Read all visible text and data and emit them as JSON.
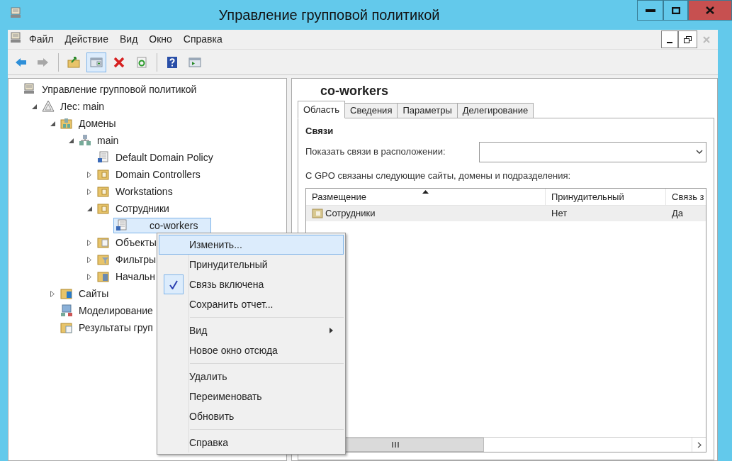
{
  "window": {
    "title": "Управление групповой политикой"
  },
  "menu_bar": [
    "Файл",
    "Действие",
    "Вид",
    "Окно",
    "Справка"
  ],
  "toolbar": [
    {
      "kind": "back",
      "disabled": false
    },
    {
      "kind": "forward",
      "disabled": true
    },
    {
      "kind": "sep"
    },
    {
      "kind": "up",
      "disabled": false
    },
    {
      "kind": "tree",
      "disabled": false,
      "selected": true
    },
    {
      "kind": "delete",
      "disabled": false
    },
    {
      "kind": "refresh",
      "disabled": false
    },
    {
      "kind": "sep"
    },
    {
      "kind": "help",
      "disabled": false
    },
    {
      "kind": "pane",
      "disabled": false
    }
  ],
  "tree": [
    {
      "label": "Управление групповой политикой",
      "kind": "console",
      "selected": false,
      "children": [
        {
          "label": "Лес: main",
          "kind": "forest",
          "expanded": true,
          "selected": false,
          "children": [
            {
              "label": "Домены",
              "kind": "domains",
              "expanded": true,
              "selected": false,
              "children": [
                {
                  "label": "main",
                  "kind": "domain",
                  "expanded": true,
                  "selected": false,
                  "children": [
                    {
                      "label": "Default Domain Policy",
                      "kind": "gpo",
                      "selected": false
                    },
                    {
                      "label": "Domain Controllers",
                      "kind": "ou",
                      "expanded": false,
                      "selected": false
                    },
                    {
                      "label": "Workstations",
                      "kind": "ou",
                      "expanded": false,
                      "selected": false
                    },
                    {
                      "label": "Сотрудники",
                      "kind": "ou",
                      "expanded": true,
                      "selected": false,
                      "children": [
                        {
                          "label": "co-workers",
                          "kind": "gpo",
                          "selected": true
                        }
                      ]
                    },
                    {
                      "label": "Объекты",
                      "kind": "folder",
                      "expanded": false,
                      "selected": false
                    },
                    {
                      "label": "Фильтры",
                      "kind": "filter",
                      "expanded": false,
                      "selected": false
                    },
                    {
                      "label": "Начальн",
                      "kind": "starter",
                      "expanded": false,
                      "selected": false
                    }
                  ]
                }
              ]
            },
            {
              "label": "Сайты",
              "kind": "sites",
              "expanded": false,
              "selected": false
            },
            {
              "label": "Моделирование",
              "kind": "modeling",
              "selected": false
            },
            {
              "label": "Результаты груп",
              "kind": "results",
              "selected": false
            }
          ]
        }
      ]
    }
  ],
  "details": {
    "title": "co-workers",
    "tabs": [
      {
        "label": "Область",
        "selected": true
      },
      {
        "label": "Сведения",
        "selected": false
      },
      {
        "label": "Параметры",
        "selected": false
      },
      {
        "label": "Делегирование",
        "selected": false
      }
    ],
    "section": "Связи",
    "location_label": "Показать связи в расположении:",
    "links_caption": "С GPO связаны следующие сайты, домены и подразделения:",
    "table": {
      "columns": [
        "Размещение",
        "Принудительный",
        "Связь з"
      ],
      "rows": [
        {
          "cells": [
            "Сотрудники",
            "Нет",
            "Да"
          ],
          "selected": true
        }
      ]
    }
  },
  "context_menu": [
    {
      "kind": "item",
      "label": "Изменить...",
      "selected": true,
      "checked": false
    },
    {
      "kind": "item",
      "label": "Принудительный",
      "selected": false,
      "checked": false
    },
    {
      "kind": "item",
      "label": "Связь включена",
      "selected": false,
      "checked": true
    },
    {
      "kind": "item",
      "label": "Сохранить отчет...",
      "selected": false,
      "checked": false
    },
    {
      "kind": "separator"
    },
    {
      "kind": "submenu",
      "label": "Вид",
      "selected": false,
      "checked": false
    },
    {
      "kind": "item",
      "label": "Новое окно отсюда",
      "selected": false,
      "checked": false
    },
    {
      "kind": "separator"
    },
    {
      "kind": "item",
      "label": "Удалить",
      "selected": false,
      "checked": false
    },
    {
      "kind": "item",
      "label": "Переименовать",
      "selected": false,
      "checked": false
    },
    {
      "kind": "item",
      "label": "Обновить",
      "selected": false,
      "checked": false
    },
    {
      "kind": "separator"
    },
    {
      "kind": "item",
      "label": "Справка",
      "selected": false,
      "checked": false
    }
  ]
}
